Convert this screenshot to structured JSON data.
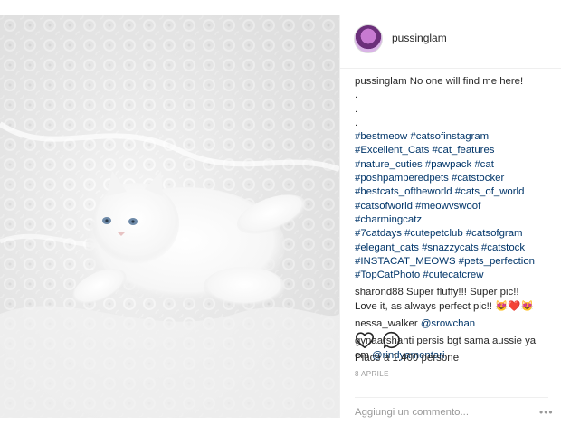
{
  "post": {
    "username": "pussinglam",
    "photo_alt": "white cat on lace",
    "caption": {
      "username": "pussinglam",
      "text": "No one will find me here!",
      "dots": [
        ".",
        ".",
        "."
      ],
      "hashtag_lines": [
        "#bestmeow #catsofinstagram",
        "#Excellent_Cats #cat_features",
        "#nature_cuties  #pawpack #cat",
        "#poshpamperedpets #catstocker",
        "#bestcats_oftheworld #cats_of_world",
        "#catsofworld #meowvswoof",
        "#charmingcatz",
        "#7catdays #cutepetclub #catsofgram",
        "#elegant_cats #snazzycats #catstock",
        "#INSTACAT_MEOWS #pets_perfection",
        "#TopCatPhoto #cutecatcrew"
      ]
    },
    "comments": [
      {
        "username": "sharond88",
        "text1": "Super fluffy!!! Super pic!!",
        "text2": "Love it, as always perfect pic!!",
        "emoji": "😻❤️😻"
      },
      {
        "username": "nessa_walker",
        "mention": "@srowchan"
      },
      {
        "username": "gynaarshanti",
        "text1": "persis bgt sama aussie ya",
        "text2": "em",
        "mention": "@rindyamentari"
      }
    ],
    "actions": {
      "like_icon": "heart-icon",
      "comment_icon": "speech-bubble-icon"
    },
    "likes": "Piace a 1.400 persone",
    "date": "8 APRILE",
    "comment_placeholder": "Aggiungi un commento...",
    "more_options": "•••"
  }
}
